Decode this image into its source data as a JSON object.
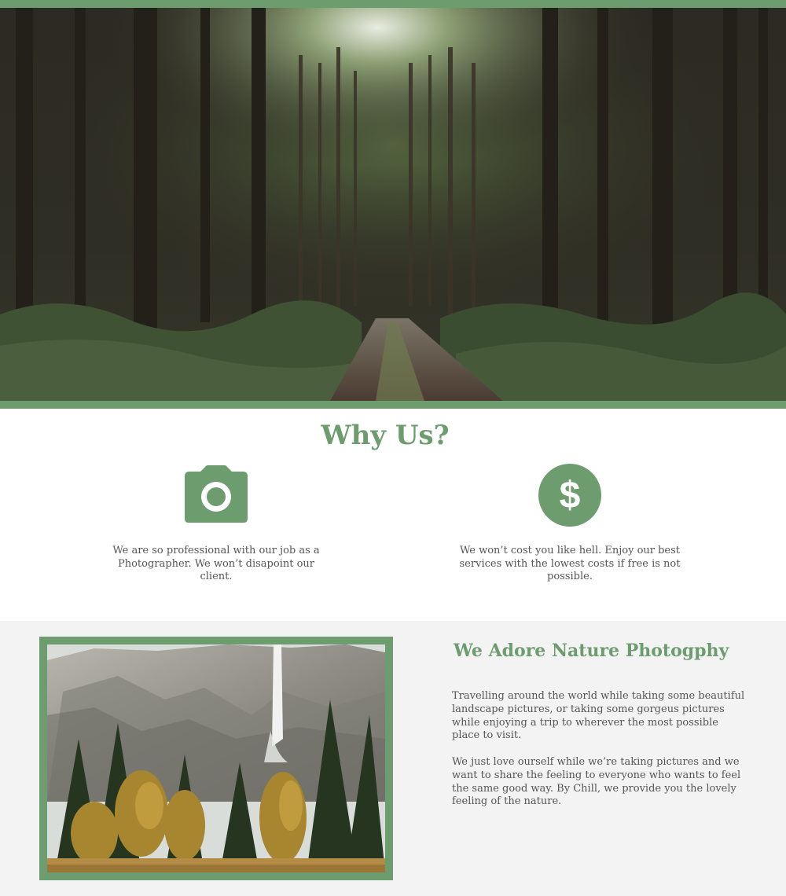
{
  "colors": {
    "accent": "#6d9c6f",
    "body_text": "#555555",
    "section_bg": "#f3f3f3"
  },
  "hero": {
    "image": "forest-road-photo"
  },
  "why_us": {
    "title": "Why Us?",
    "features": [
      {
        "icon": "camera-icon",
        "text": "We are so professional with our job as a Photographer. We won’t disapoint our client."
      },
      {
        "icon": "dollar-icon",
        "text": "We won’t cost you like hell. Enjoy our best services with the lowest costs if free is not possible."
      }
    ]
  },
  "about": {
    "image": "waterfall-mountain-photo",
    "title": "We Adore Nature Photogphy",
    "paragraphs": [
      "Travelling around the world while taking some beautiful landscape pictures, or taking some gorgeus pictures while enjoying a trip to wherever the most possible place to visit.",
      "We just love ourself while we’re taking pictures and we want to share the feeling to everyone who wants to feel the same good way. By Chill, we provide you the lovely feeling of the nature."
    ]
  }
}
